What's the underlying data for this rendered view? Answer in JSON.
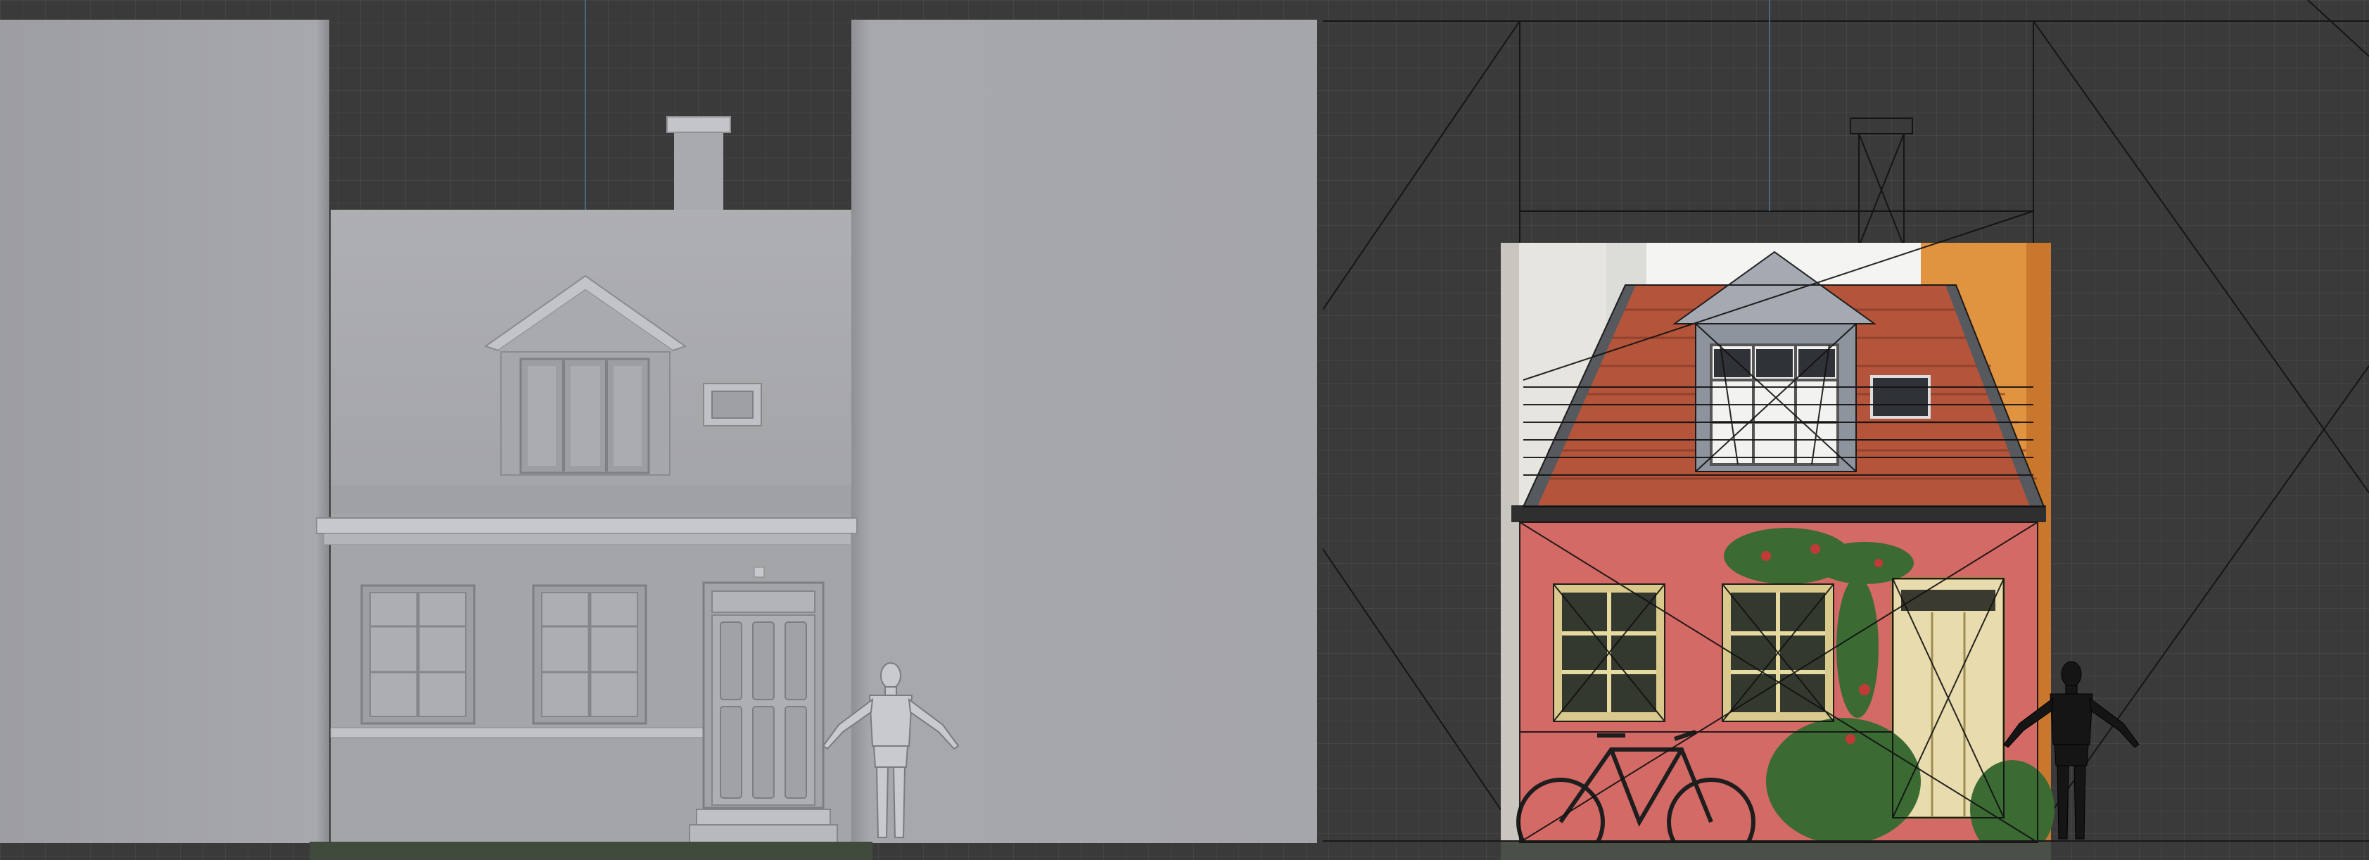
{
  "app": {
    "view_mode": "orthographic-front",
    "grid": true
  },
  "scene": {
    "left_viewport": {
      "shading": "clay-grey",
      "objects": [
        "house-model",
        "background-wall-left",
        "background-wall-right",
        "human-reference-figure"
      ]
    },
    "right_viewport": {
      "shading": "wireframe-over-photo",
      "objects": [
        "reference-photo",
        "house-wireframe",
        "human-silhouette-figure",
        "camera-frustum-lines"
      ]
    }
  },
  "colors": {
    "viewport_bg": "#3a3a3a",
    "clay": "#a6a7ab",
    "clay_dark": "#8d8e92",
    "clay_light": "#c2c3c7",
    "wire": "#111111",
    "roof_tile": "#b4553b",
    "wall_pink": "#d46a66",
    "orange_wall": "#e1943f",
    "door_cream": "#e8dcae"
  }
}
